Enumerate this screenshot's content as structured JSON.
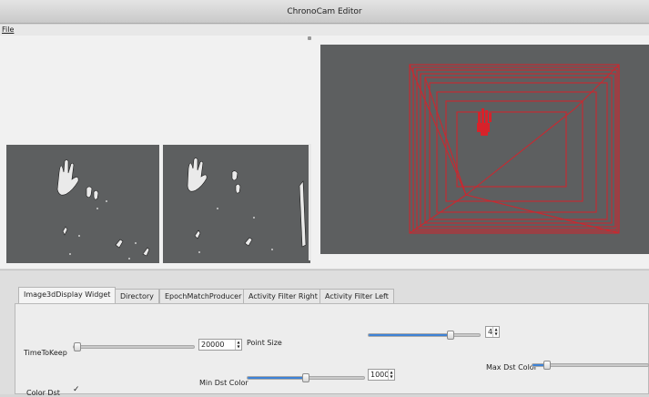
{
  "window": {
    "title": "ChronoCam Editor"
  },
  "menu": {
    "file": "File"
  },
  "tabs": [
    {
      "label": "Image3dDisplay Widget"
    },
    {
      "label": "Directory"
    },
    {
      "label": "EpochMatchProducer"
    },
    {
      "label": "Activity Filter Right"
    },
    {
      "label": "Activity Filter Left"
    }
  ],
  "controls": {
    "time_to_keep": {
      "label": "TimeToKeep",
      "value": "20000",
      "slider_fraction": 0.0
    },
    "point_size": {
      "label": "Point Size",
      "value": "4",
      "slider_fraction": 0.75
    },
    "min_dst_color": {
      "label": "Min Dst Color",
      "value": "1000",
      "slider_fraction": 0.5
    },
    "max_dst_color": {
      "label": "Max Dst Color",
      "slider_fraction": 0.1
    },
    "color_dst": {
      "label": "Color Dst",
      "checked": true,
      "check_glyph": "✓"
    }
  },
  "colors": {
    "accent": "#3d82d6",
    "trace": "#d7222a",
    "view_bg": "#5d5f60"
  }
}
